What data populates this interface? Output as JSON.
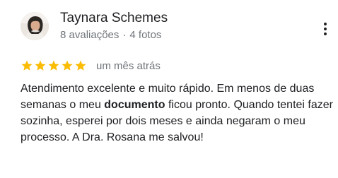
{
  "reviewer": {
    "name": "Taynara Schemes",
    "reviews_count": "8 avaliações",
    "separator": "·",
    "photos_count": "4 fotos"
  },
  "review": {
    "rating": 5,
    "max_rating": 5,
    "date": "um mês atrás",
    "text_before_bold": "Atendimento excelente e muito rápido. Em menos de duas semanas o meu ",
    "text_bold": "documento",
    "text_after_bold": " ficou pronto. Quando tentei fazer sozinha, esperei por dois meses e ainda negaram o meu processo. A Dra. Rosana me salvou!"
  },
  "icons": {
    "avatar": "reviewer-photo",
    "star": "star-icon",
    "more": "more-vert-icon"
  },
  "colors": {
    "star": "#fbbc04",
    "text_primary": "#202124",
    "text_secondary": "#70757a"
  }
}
